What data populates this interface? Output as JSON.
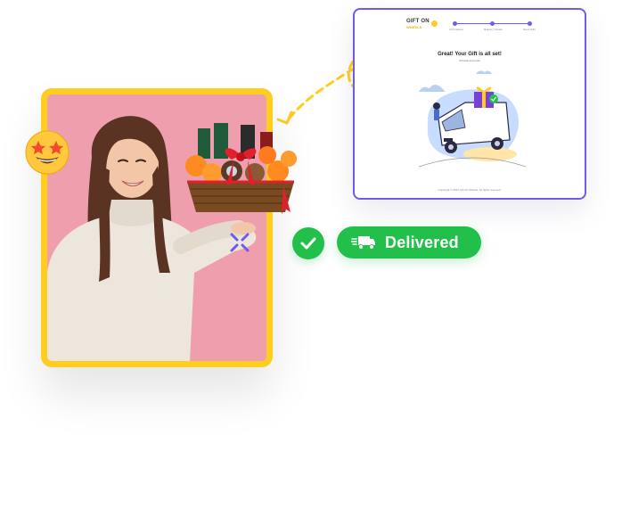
{
  "screen_panel": {
    "logo_text": "GIFT ON",
    "logo_sub": "WHEELS",
    "steps": [
      "Gift Options",
      "Delivery Details",
      "Send Gifts"
    ],
    "headline": "Great! Your Gift is all set!",
    "subline": "Sit back and relax",
    "footer": "Copyright © 2024 Gift On Wheels. All rights reserved."
  },
  "status": {
    "label": "Delivered"
  },
  "colors": {
    "accent_yellow": "#ffcd1f",
    "accent_purple": "#6f5ce8",
    "success_green": "#22c04a",
    "photo_background": "#ef9eae"
  },
  "icons": {
    "emoji": "star-struck-emoji-icon",
    "sparkle": "sparkle-icon",
    "check": "check-icon",
    "truck": "delivery-truck-icon"
  }
}
